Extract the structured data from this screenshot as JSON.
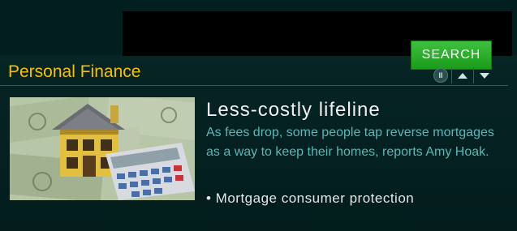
{
  "search": {
    "label": "SEARCH"
  },
  "section": {
    "title": "Personal Finance"
  },
  "controls": {
    "pause_glyph": "II",
    "icons": [
      "pause-icon",
      "arrow-up-icon",
      "arrow-down-icon"
    ]
  },
  "story": {
    "headline": "Less-costly lifeline",
    "summary": "As fees drop, some people tap reverse mortgages as a way to keep their homes, reports Amy Hoak.",
    "related": "• Mortgage consumer protection"
  },
  "colors": {
    "title": "#f4c200",
    "summary": "#58b8b8",
    "button": "#2aa62a",
    "background": "#062323"
  }
}
